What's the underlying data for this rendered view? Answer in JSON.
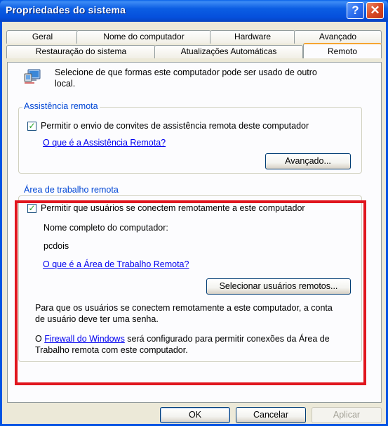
{
  "window": {
    "title": "Propriedades do sistema"
  },
  "tabs_row1": [
    {
      "label": "Geral"
    },
    {
      "label": "Nome do computador"
    },
    {
      "label": "Hardware"
    },
    {
      "label": "Avançado"
    }
  ],
  "tabs_row2": [
    {
      "label": "Restauração do sistema"
    },
    {
      "label": "Atualizações Automáticas"
    },
    {
      "label": "Remoto",
      "active": true
    }
  ],
  "intro": {
    "text_line1": "Selecione de que formas este computador pode ser usado de outro",
    "text_line2": "local."
  },
  "remote_assistance": {
    "legend": "Assistência remota",
    "checkbox_label": "Permitir o envio de convites de assistência remota deste computador",
    "checked": true,
    "link": "O que é a Assistência Remota?",
    "advanced_button": "Avançado..."
  },
  "remote_desktop": {
    "legend": "Área de trabalho remota",
    "checkbox_label": "Permitir que usuários se conectem remotamente a este computador",
    "checked": true,
    "full_name_label": "Nome completo do computador:",
    "computer_name": "pcdois",
    "link": "O que é a Área de Trabalho Remota?",
    "select_users_button": "Selecionar usuários remotos...",
    "password_note_line1": "Para que os usuários se conectem remotamente a este computador, a conta",
    "password_note_line2": "de usuário deve ter uma senha.",
    "firewall_prefix": "O ",
    "firewall_link": "Firewall do Windows",
    "firewall_suffix_line1": " será configurado para permitir conexões da Área de",
    "firewall_line2": "Trabalho remota com este computador."
  },
  "footer": {
    "ok": "OK",
    "cancel": "Cancelar",
    "apply": "Aplicar"
  },
  "colors": {
    "highlight_box": "#e0161e",
    "title_bar": "#0054e3",
    "legend": "#0046d5",
    "link": "#0000ee"
  }
}
